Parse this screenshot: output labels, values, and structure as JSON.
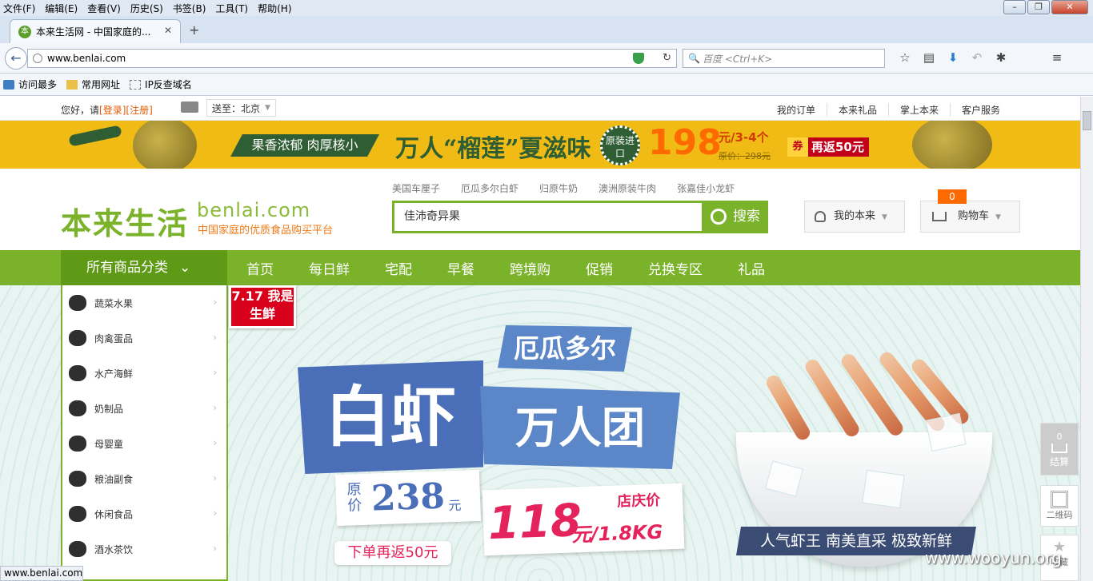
{
  "menu": [
    "文件(F)",
    "编辑(E)",
    "查看(V)",
    "历史(S)",
    "书签(B)",
    "工具(T)",
    "帮助(H)"
  ],
  "tab": {
    "title": "本来生活网 - 中国家庭的...",
    "favicon": "本"
  },
  "address": {
    "url": "www.benlai.com",
    "search_placeholder": "百度 <Ctrl+K>"
  },
  "bookmarks": [
    "访问最多",
    "常用网址",
    "IP反查域名"
  ],
  "topbar": {
    "hello": "您好，请",
    "login": "[登录]",
    "register": "[注册]",
    "sendto": "送至：北京",
    "links": [
      "我的订单",
      "本来礼品",
      "掌上本来",
      "客户服务"
    ]
  },
  "banner": {
    "tagline": "果香浓郁 肉厚核小",
    "title": "万人“榴莲”夏滋味",
    "badge": "原装进口",
    "price": "198",
    "unit": "元/3-4个",
    "original": "原价：298元",
    "coupon_tag": "券",
    "coupon": "再返50元"
  },
  "header": {
    "logo": "本来生活",
    "logo_en": "benlai.com",
    "slogan": "中国家庭的优质食品购买平台",
    "hot": [
      "美国车厘子",
      "厄瓜多尔白虾",
      "归原牛奶",
      "澳洲原装牛肉",
      "张嘉佳小龙虾"
    ],
    "search_value": "佳沛奇异果",
    "search_button": "搜索",
    "my_benlai": "我的本来",
    "cart": "购物车",
    "cart_count": "0"
  },
  "nav": {
    "all": "所有商品分类",
    "items": [
      "首页",
      "每日鲜",
      "宅配",
      "早餐",
      "跨境购",
      "促销",
      "兑换专区",
      "礼品"
    ]
  },
  "categories": [
    "蔬菜水果",
    "肉禽蛋品",
    "水产海鲜",
    "奶制品",
    "母婴童",
    "粮油副食",
    "休闲食品",
    "酒水茶饮"
  ],
  "hero": {
    "tag": "7.17 我是生鲜",
    "origin": "厄瓜多尔",
    "big": "白虾",
    "group": "万人团",
    "orig_label": "原价",
    "orig_price": "238",
    "orig_unit": "元",
    "sale_price": "118",
    "sale_unit": "元/1.8KG",
    "sale_label": "店庆价",
    "rebate": "下单再返50元",
    "slogan": "人气虾王 南美直采 极致新鲜"
  },
  "float": {
    "cart_count": "0",
    "checkout": "结算",
    "qr": "二维码",
    "fav": "收藏"
  },
  "status": "www.benlai.com",
  "watermark": "www.wooyun.org",
  "colors": {
    "brand_green": "#7ab22a",
    "orange": "#ff6a00",
    "banner_yellow": "#efbb14"
  }
}
